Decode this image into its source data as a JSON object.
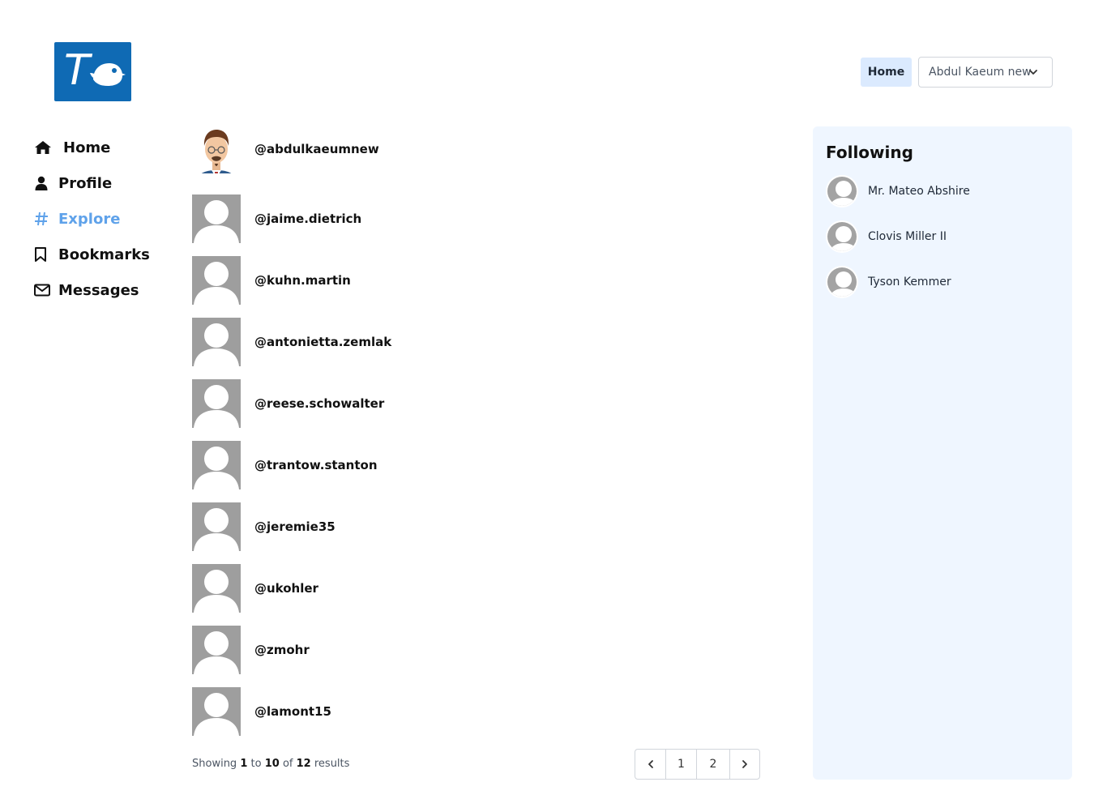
{
  "header": {
    "home_label": "Home",
    "user_menu_label": "Abdul Kaeum new"
  },
  "logo": {
    "letter": "T"
  },
  "nav": {
    "items": [
      {
        "label": "Home",
        "icon": "home-icon"
      },
      {
        "label": "Profile",
        "icon": "user-icon"
      },
      {
        "label": "Explore",
        "icon": "hashtag-icon",
        "active": true
      },
      {
        "label": "Bookmarks",
        "icon": "bookmark-icon"
      },
      {
        "label": "Messages",
        "icon": "envelope-icon"
      }
    ]
  },
  "users": [
    {
      "handle": "@abdulkaeumnew",
      "avatar": "custom-avatar"
    },
    {
      "handle": "@jaime.dietrich",
      "avatar": "default-avatar"
    },
    {
      "handle": "@kuhn.martin",
      "avatar": "default-avatar"
    },
    {
      "handle": "@antonietta.zemlak",
      "avatar": "default-avatar"
    },
    {
      "handle": "@reese.schowalter",
      "avatar": "default-avatar"
    },
    {
      "handle": "@trantow.stanton",
      "avatar": "default-avatar"
    },
    {
      "handle": "@jeremie35",
      "avatar": "default-avatar"
    },
    {
      "handle": "@ukohler",
      "avatar": "default-avatar"
    },
    {
      "handle": "@zmohr",
      "avatar": "default-avatar"
    },
    {
      "handle": "@lamont15",
      "avatar": "default-avatar"
    }
  ],
  "pagination": {
    "showing_prefix": "Showing",
    "from": "1",
    "to_word": "to",
    "to": "10",
    "of_word": "of",
    "total": "12",
    "results_word": "results",
    "pages": [
      "1",
      "2"
    ]
  },
  "following": {
    "title": "Following",
    "people": [
      {
        "name": "Mr. Mateo Abshire"
      },
      {
        "name": "Clovis Miller II"
      },
      {
        "name": "Tyson Kemmer"
      }
    ]
  },
  "colors": {
    "brand": "#0f6ab4",
    "active_nav": "#5fa2ea",
    "sidebar_bg": "#eff6ff",
    "home_button_bg": "#dbeafe"
  }
}
